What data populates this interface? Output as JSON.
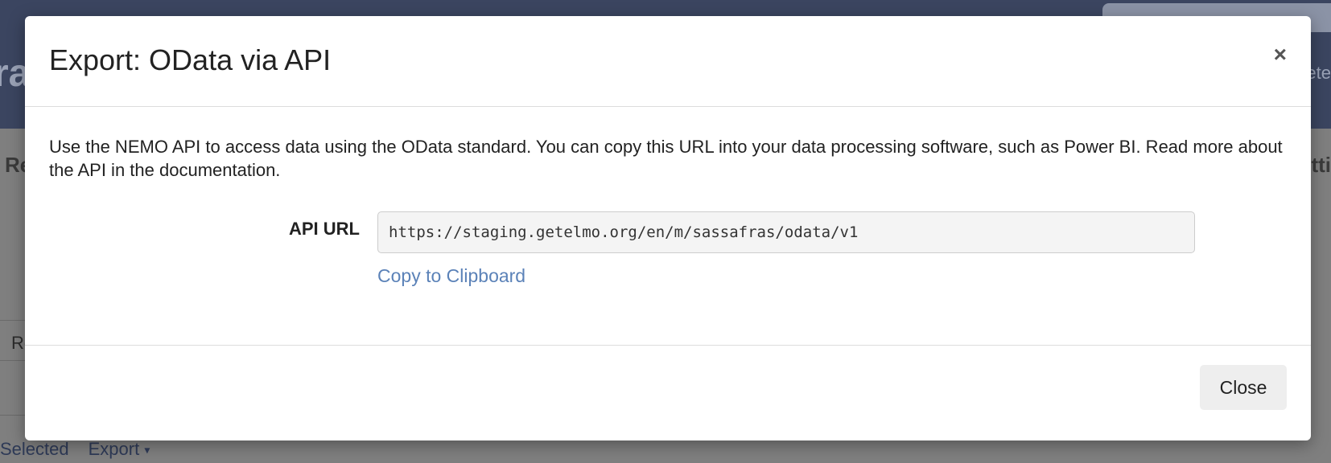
{
  "background": {
    "nav_title_fragment": "ra",
    "nav_right_fragment": "ete",
    "heading_left_fragment": "Re",
    "heading_right_fragment": "tti",
    "table_cell_fragment": "Re",
    "bottom_bar": {
      "selected_label": "Selected",
      "export_label": "Export",
      "export_caret": "▾"
    }
  },
  "modal": {
    "title": "Export: OData via API",
    "close_x": "×",
    "description": "Use the NEMO API to access data using the OData standard. You can copy this URL into your data processing software, such as Power BI. Read more about the API in the documentation.",
    "api_url_label": "API URL",
    "api_url_value": "https://staging.getelmo.org/en/m/sassafras/odata/v1",
    "copy_link_label": "Copy to Clipboard",
    "close_button_label": "Close"
  },
  "colors": {
    "navbar": "#3b4560",
    "link": "#5b82b8",
    "overlay": "#7f7f7f"
  }
}
